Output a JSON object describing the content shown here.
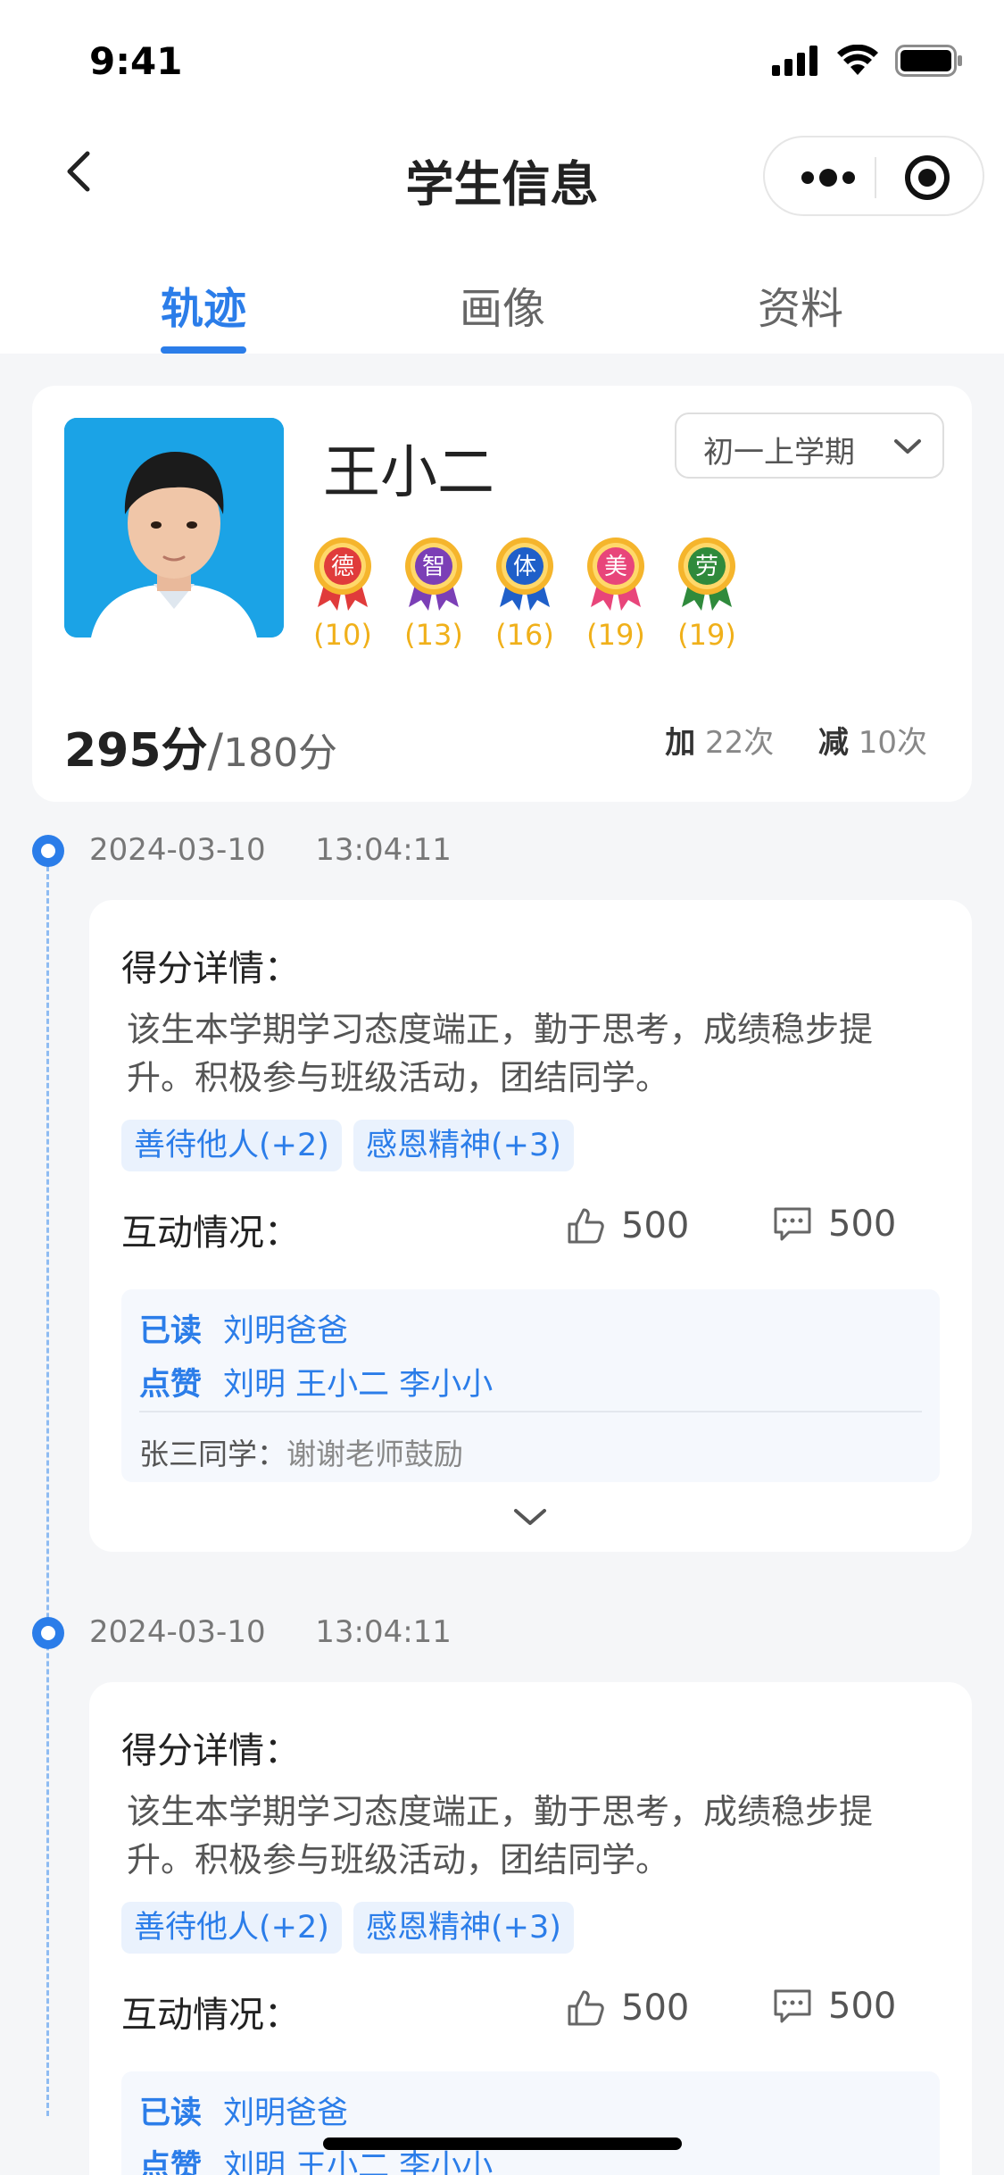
{
  "status": {
    "time": "9:41"
  },
  "nav": {
    "title": "学生信息"
  },
  "tabs": [
    {
      "label": "轨迹",
      "active": true
    },
    {
      "label": "画像",
      "active": false
    },
    {
      "label": "资料",
      "active": false
    }
  ],
  "student": {
    "name": "王小二",
    "term": "初一上学期",
    "badges": [
      {
        "char": "德",
        "count": "(10)",
        "color": "#e03b3b"
      },
      {
        "char": "智",
        "count": "(13)",
        "color": "#7b3fb6"
      },
      {
        "char": "体",
        "count": "(16)",
        "color": "#1f5fc9"
      },
      {
        "char": "美",
        "count": "(19)",
        "color": "#e8457a"
      },
      {
        "char": "劳",
        "count": "(19)",
        "color": "#2f8a3c"
      }
    ],
    "score": "295分",
    "score_sep": "/",
    "score_total": "180分",
    "add_label": "加",
    "add_count": "22次",
    "sub_label": "减",
    "sub_count": "10次"
  },
  "entries": [
    {
      "date": "2024-03-10",
      "time": "13:04:11",
      "detail_title": "得分详情：",
      "detail_text": "该生本学期学习态度端正，勤于思考，成绩稳步提升。积极参与班级活动，团结同学。",
      "tags": [
        "善待他人(+2)",
        "感恩精神(+3)"
      ],
      "interaction_title": "互动情况：",
      "likes": "500",
      "comments": "500",
      "read_label": "已读",
      "read_names": "刘明爸爸",
      "like_label": "点赞",
      "like_names": "刘明 王小二 李小小",
      "comment_user": "张三同学：",
      "comment_text": "谢谢老师鼓励"
    },
    {
      "date": "2024-03-10",
      "time": "13:04:11",
      "detail_title": "得分详情：",
      "detail_text": "该生本学期学习态度端正，勤于思考，成绩稳步提升。积极参与班级活动，团结同学。",
      "tags": [
        "善待他人(+2)",
        "感恩精神(+3)"
      ],
      "interaction_title": "互动情况：",
      "likes": "500",
      "comments": "500",
      "read_label": "已读",
      "read_names": "刘明爸爸",
      "like_label": "点赞",
      "like_names": "刘明 王小二 李小小"
    }
  ],
  "colors": {
    "accent": "#2b7de9",
    "gold": "#f0b01a",
    "background": "#f5f6f8"
  }
}
